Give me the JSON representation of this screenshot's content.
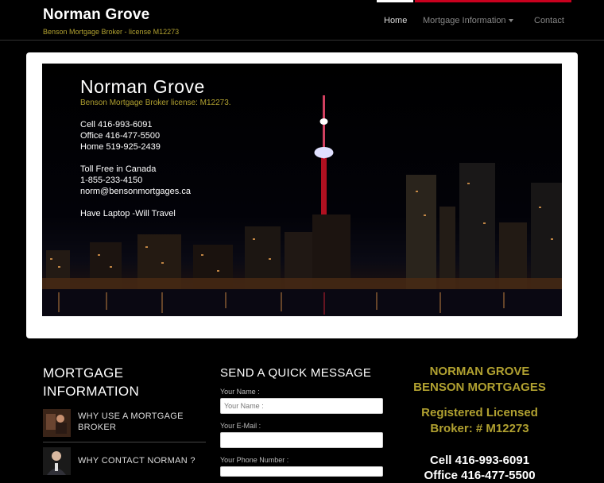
{
  "header": {
    "brand": "Norman Grove",
    "subtitle": "Benson Mortgage Broker - license M12273",
    "nav": {
      "home": "Home",
      "mortgage": "Mortgage Information",
      "contact": "Contact"
    }
  },
  "banner": {
    "title": "Norman Grove",
    "subtitle": "Benson Mortgage Broker license: M12273.",
    "lines": [
      "Cell    416-993-6091",
      "Office 416-477-5500",
      "Home 519-925-2439",
      "Toll Free in Canada",
      "1-855-233-4150",
      "norm@bensonmortgages.ca",
      "Have Laptop -Will Travel"
    ]
  },
  "mortgage_info": {
    "title": "MORTGAGE INFORMATION",
    "items": [
      {
        "label": "WHY USE A MORTGAGE BROKER"
      },
      {
        "label": "WHY CONTACT NORMAN ?"
      }
    ]
  },
  "message_form": {
    "title": "SEND A QUICK MESSAGE",
    "name_label": "Your Name :",
    "name_placeholder": "Your Name :",
    "email_label": "Your E-Mail :",
    "phone_label": "Your Phone Number :"
  },
  "contact_box": {
    "line1": "NORMAN GROVE",
    "line2": "BENSON MORTGAGES",
    "line3": "Registered Licensed",
    "line4": "Broker: # M12273",
    "cell": "Cell 416-993-6091",
    "office": "Office 416-477-5500"
  },
  "colors": {
    "accent_gold": "#b0a030",
    "accent_red": "#c8001e",
    "background": "#000000"
  }
}
